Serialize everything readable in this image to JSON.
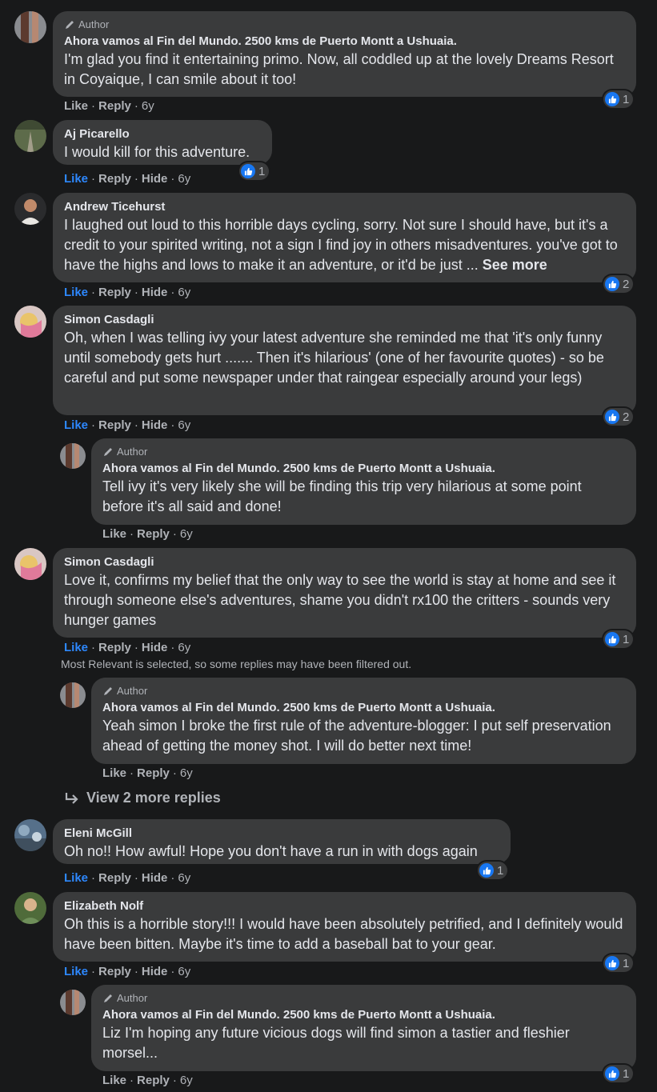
{
  "labels": {
    "like": "Like",
    "reply": "Reply",
    "hide": "Hide",
    "separator": "·",
    "author_tag": "Author",
    "see_more": "See more"
  },
  "colors": {
    "background": "#18191a",
    "bubble": "#3a3b3c",
    "like_active": "#2d88ff",
    "reaction_blue": "#1877f2"
  },
  "comments": [
    {
      "name": "Ahora vamos al Fin del Mundo. 2500 kms de Puerto Montt a Ushuaia.",
      "is_author": true,
      "text": "I'm glad you find it entertaining primo. Now, all coddled up at the lovely Dreams Resort in Coyaique, I can smile about it too!",
      "time": "6y",
      "reactions": "1",
      "liked": false
    },
    {
      "name": "Aj Picarello",
      "text": "I would kill for this adventure.",
      "time": "6y",
      "reactions": "1",
      "liked": true
    },
    {
      "name": "Andrew Ticehurst",
      "text": "I laughed out loud to this horrible days cycling, sorry. Not sure I should have, but it's a credit to your spirited writing, not a sign I find joy in others misadventures. you've got to have the highs and lows to make it an adventure, or it'd be just ...",
      "time": "6y",
      "reactions": "2",
      "liked": true
    },
    {
      "name": "Simon Casdagli",
      "text": "Oh, when I was telling ivy your latest adventure she reminded me that 'it's only funny until somebody gets hurt ....... Then it's hilarious' (one of her favourite quotes) - so be careful and put some newspaper under that raingear especially around your legs)",
      "time": "6y",
      "reactions": "2",
      "liked": true
    },
    {
      "name": "Ahora vamos al Fin del Mundo. 2500 kms de Puerto Montt a Ushuaia.",
      "is_author": true,
      "text": "Tell ivy it's very likely she will be finding this trip very hilarious at some point before it's all said and done!",
      "time": "6y",
      "liked": false
    },
    {
      "name": "Simon Casdagli",
      "text": "Love it, confirms my belief that the only way to see the world is stay at home and see it through someone else's adventures, shame you didn't rx100 the critters - sounds very hunger games",
      "time": "6y",
      "reactions": "1",
      "liked": true
    },
    {
      "name": "Ahora vamos al Fin del Mundo. 2500 kms de Puerto Montt a Ushuaia.",
      "is_author": true,
      "text": "Yeah simon I broke the first rule of the adventure-blogger: I put self preservation ahead of getting the money shot. I will do better next time!",
      "time": "6y",
      "liked": false
    },
    {
      "name": "Eleni McGill",
      "text": "Oh no!! How awful! Hope you don't have a run in with dogs again",
      "time": "6y",
      "reactions": "1",
      "liked": true
    },
    {
      "name": "Elizabeth Nolf",
      "text": "Oh this is a horrible story!!! I would have been absolutely petrified, and I definitely would have been bitten. Maybe it's time to add a baseball bat to your gear.",
      "time": "6y",
      "reactions": "1",
      "liked": true
    },
    {
      "name": "Ahora vamos al Fin del Mundo. 2500 kms de Puerto Montt a Ushuaia.",
      "is_author": true,
      "text": "Liz I'm hoping any future vicious dogs will find simon a tastier and fleshier morsel...",
      "time": "6y",
      "reactions": "1",
      "liked": false
    }
  ],
  "filter_notice": "Most Relevant is selected, so some replies may have been filtered out.",
  "view_more_replies": "View 2 more replies"
}
